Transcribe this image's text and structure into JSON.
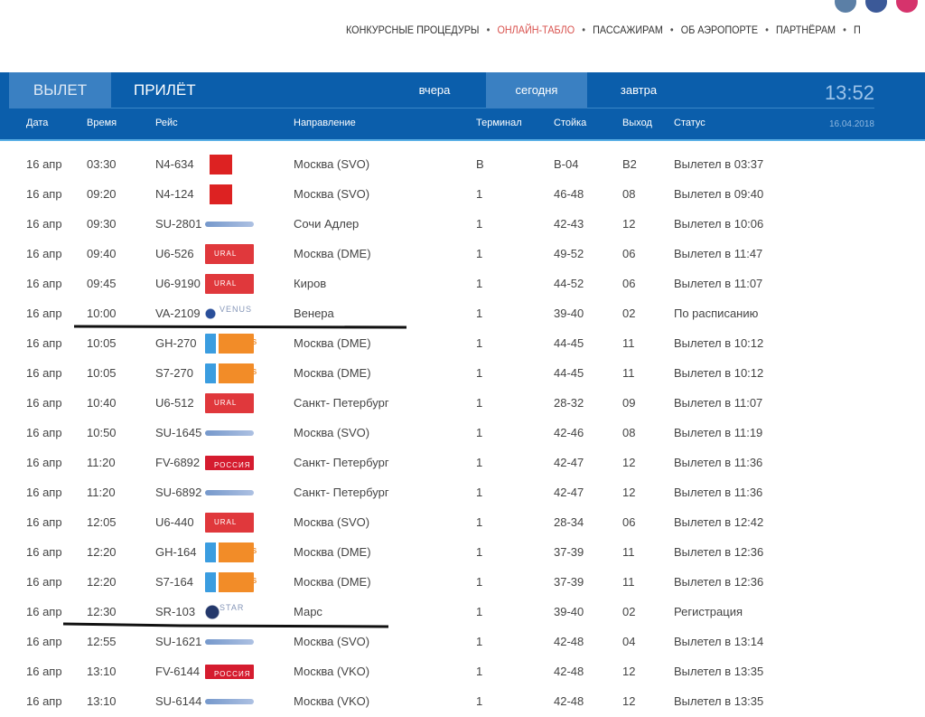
{
  "social": [
    {
      "icon": "vk-icon",
      "color": "#5b7fa6"
    },
    {
      "icon": "facebook-icon",
      "color": "#3b5998"
    },
    {
      "icon": "instagram-icon",
      "color": "#d6336c"
    }
  ],
  "nav": [
    "КОНКУРСНЫЕ ПРОЦЕДУРЫ",
    "ОНЛАЙН-ТАБЛО",
    "ПАССАЖИРАМ",
    "ОБ АЭРОПОРТЕ",
    "ПАРТНЁРАМ",
    "П"
  ],
  "nav_active": 1,
  "board": {
    "tabs": [
      "ВЫЛЕТ",
      "ПРИЛЁТ"
    ],
    "days": [
      "вчера",
      "сегодня",
      "завтра"
    ],
    "clock": "13:52",
    "date": "16.04.2018",
    "columns": [
      "Дата",
      "Время",
      "Рейс",
      "Направление",
      "Терминал",
      "Стойка",
      "Выход",
      "Статус"
    ]
  },
  "colors": {
    "board": "#0b5eab",
    "active_nav": "#d9534f"
  },
  "rows": [
    [
      "16 апр",
      "03:30",
      "N4-634",
      "nordwind",
      "Москва (SVO)",
      "B",
      "B-04",
      "B2",
      "Вылетел в 03:37"
    ],
    [
      "16 апр",
      "09:20",
      "N4-124",
      "nordwind",
      "Москва (SVO)",
      "1",
      "46-48",
      "08",
      "Вылетел в 09:40"
    ],
    [
      "16 апр",
      "09:30",
      "SU-2801",
      "aeroflot",
      "Сочи Адлер",
      "1",
      "42-43",
      "12",
      "Вылетел в 10:06"
    ],
    [
      "16 апр",
      "09:40",
      "U6-526",
      "ural",
      "Москва (DME)",
      "1",
      "49-52",
      "06",
      "Вылетел в 11:47"
    ],
    [
      "16 апр",
      "09:45",
      "U6-9190",
      "ural",
      "Киров",
      "1",
      "44-52",
      "06",
      "Вылетел в 11:07"
    ],
    [
      "16 апр",
      "10:00",
      "VA-2109",
      "venus",
      "Венера",
      "1",
      "39-40",
      "02",
      "По расписанию"
    ],
    [
      "16 апр",
      "10:05",
      "GH-270",
      "globus",
      "Москва (DME)",
      "1",
      "44-45",
      "11",
      "Вылетел в 10:12"
    ],
    [
      "16 апр",
      "10:05",
      "S7-270",
      "globus",
      "Москва (DME)",
      "1",
      "44-45",
      "11",
      "Вылетел в 10:12"
    ],
    [
      "16 апр",
      "10:40",
      "U6-512",
      "ural",
      "Санкт- Петербург",
      "1",
      "28-32",
      "09",
      "Вылетел в 11:07"
    ],
    [
      "16 апр",
      "10:50",
      "SU-1645",
      "aeroflot",
      "Москва (SVO)",
      "1",
      "42-46",
      "08",
      "Вылетел в 11:19"
    ],
    [
      "16 апр",
      "11:20",
      "FV-6892",
      "rossiya",
      "Санкт- Петербург",
      "1",
      "42-47",
      "12",
      "Вылетел в 11:36"
    ],
    [
      "16 апр",
      "11:20",
      "SU-6892",
      "aeroflot",
      "Санкт- Петербург",
      "1",
      "42-47",
      "12",
      "Вылетел в 11:36"
    ],
    [
      "16 апр",
      "12:05",
      "U6-440",
      "ural",
      "Москва (SVO)",
      "1",
      "28-34",
      "06",
      "Вылетел в 12:42"
    ],
    [
      "16 апр",
      "12:20",
      "GH-164",
      "globus",
      "Москва (DME)",
      "1",
      "37-39",
      "11",
      "Вылетел в 12:36"
    ],
    [
      "16 апр",
      "12:20",
      "S7-164",
      "globus",
      "Москва (DME)",
      "1",
      "37-39",
      "11",
      "Вылетел в 12:36"
    ],
    [
      "16 апр",
      "12:30",
      "SR-103",
      "starlines",
      "Марс",
      "1",
      "39-40",
      "02",
      "Регистрация"
    ],
    [
      "16 апр",
      "12:55",
      "SU-1621",
      "aeroflot",
      "Москва (SVO)",
      "1",
      "42-48",
      "04",
      "Вылетел в 13:14"
    ],
    [
      "16 апр",
      "13:10",
      "FV-6144",
      "rossiya",
      "Москва (VKO)",
      "1",
      "42-48",
      "12",
      "Вылетел в 13:35"
    ],
    [
      "16 апр",
      "13:10",
      "SU-6144",
      "aeroflot",
      "Москва (VKO)",
      "1",
      "42-48",
      "12",
      "Вылетел в 13:35"
    ]
  ],
  "logo_text": {
    "venus": "VENUS",
    "starlines": "STAR",
    "globus": "GLOBUS",
    "rossiya": "РОССИЯ",
    "ural": "URAL"
  }
}
